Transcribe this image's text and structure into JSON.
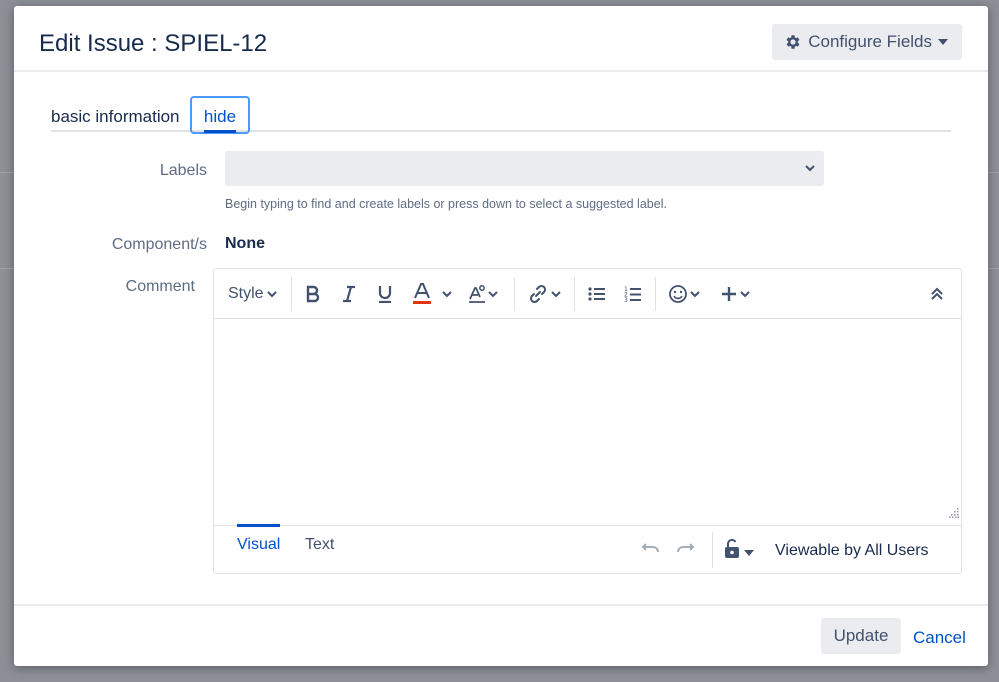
{
  "dialog": {
    "title": "Edit Issue : SPIEL-12",
    "configure_label": "Configure Fields"
  },
  "tabs": [
    {
      "label": "basic information",
      "selected": false
    },
    {
      "label": "hide",
      "selected": true
    }
  ],
  "fields": {
    "labels": {
      "label": "Labels",
      "value": "",
      "help": "Begin typing to find and create labels or press down to select a suggested label."
    },
    "components": {
      "label": "Component/s",
      "value": "None"
    },
    "comment": {
      "label": "Comment"
    }
  },
  "editor": {
    "style_label": "Style",
    "toolbar_icons": [
      "bold-icon",
      "italic-icon",
      "underline-icon",
      "text-color-icon",
      "more-formatting-icon",
      "link-icon",
      "bullet-list-icon",
      "numbered-list-icon",
      "emoji-icon",
      "insert-icon",
      "collapse-toolbar-icon"
    ],
    "modes": [
      "Visual",
      "Text"
    ],
    "active_mode": "Visual",
    "visibility": "Viewable by All Users"
  },
  "footer": {
    "update_label": "Update",
    "cancel_label": "Cancel"
  },
  "colors": {
    "accent": "#0052cc",
    "focus_ring": "#4c9aff",
    "text_color_underline": "#de350b",
    "button_bg": "#ebecf0"
  }
}
